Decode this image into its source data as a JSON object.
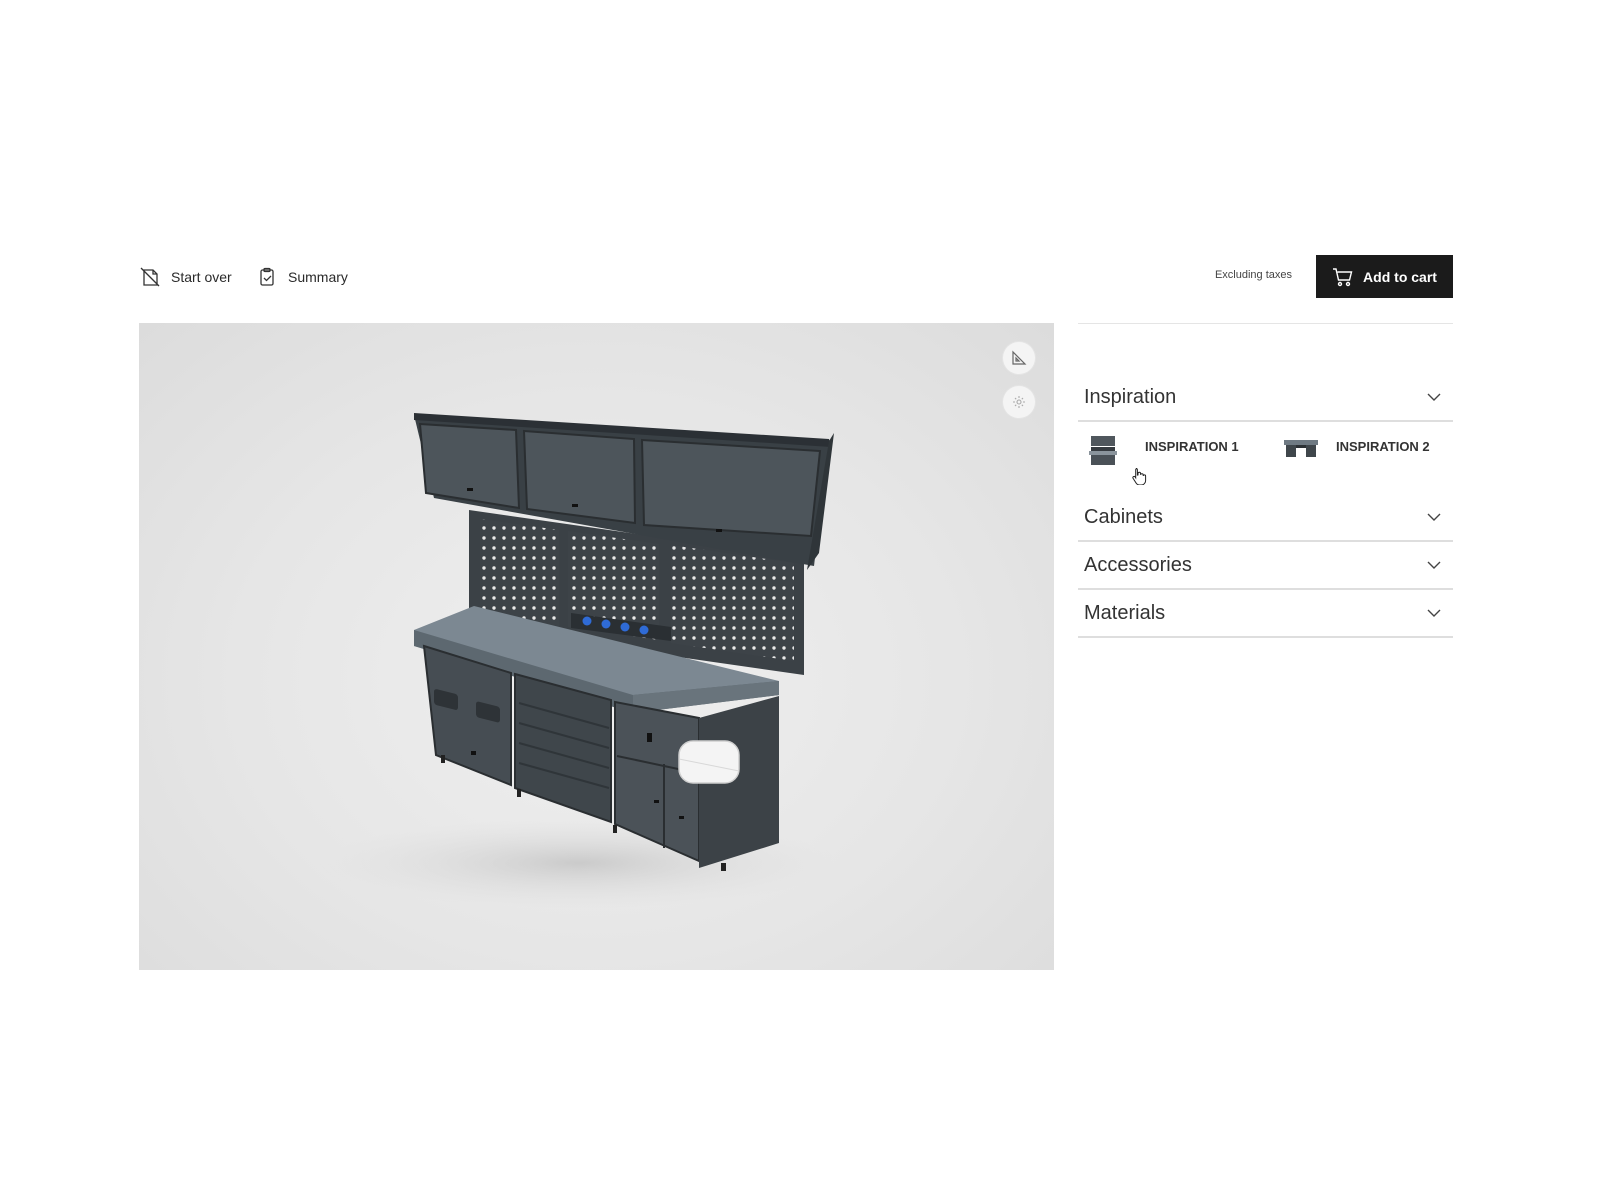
{
  "toolbar": {
    "start_over_label": "Start over",
    "summary_label": "Summary",
    "tax_note": "Excluding taxes",
    "add_to_cart_label": "Add to cart"
  },
  "viewer": {
    "tools": [
      {
        "icon": "measure-icon"
      },
      {
        "icon": "ar-view-icon"
      }
    ]
  },
  "panel": {
    "sections": [
      {
        "title": "Inspiration",
        "expanded": true
      },
      {
        "title": "Cabinets",
        "expanded": false
      },
      {
        "title": "Accessories",
        "expanded": false
      },
      {
        "title": "Materials",
        "expanded": false
      }
    ],
    "inspirations": [
      {
        "label": "INSPIRATION 1"
      },
      {
        "label": "INSPIRATION 2"
      }
    ]
  },
  "colors": {
    "button_bg": "#1b1b1b",
    "cabinet": "#4a5258",
    "worktop": "#7c8892",
    "accent_blue": "#2f6bd6"
  }
}
